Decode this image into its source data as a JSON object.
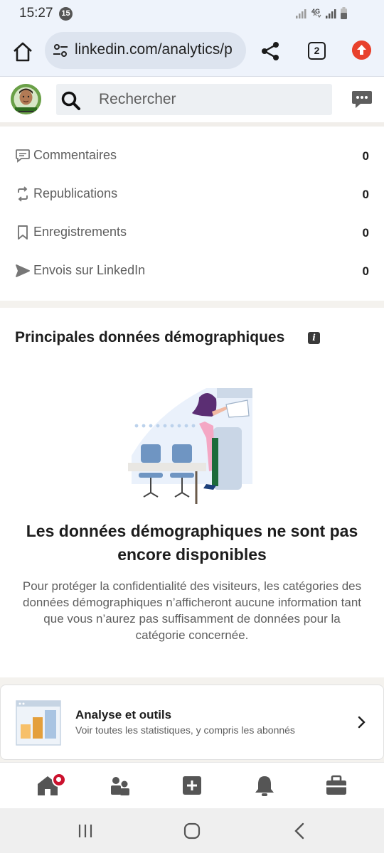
{
  "status_bar": {
    "time": "15:27",
    "notification_count": "15",
    "network": "4G"
  },
  "browser": {
    "url": "linkedin.com/analytics/p",
    "tab_count": "2"
  },
  "header": {
    "search_placeholder": "Rechercher"
  },
  "stats": [
    {
      "label": "Commentaires",
      "value": "0",
      "icon": "comment-icon"
    },
    {
      "label": "Republications",
      "value": "0",
      "icon": "repost-icon"
    },
    {
      "label": "Enregistrements",
      "value": "0",
      "icon": "bookmark-icon"
    },
    {
      "label": "Envois sur LinkedIn",
      "value": "0",
      "icon": "send-icon"
    }
  ],
  "demographics": {
    "title": "Principales données démographiques",
    "empty_heading": "Les données démographiques ne sont pas encore disponibles",
    "empty_body": "Pour protéger la confidentialité des visiteurs, les catégories des données démographiques n’afficheront aucune information tant que vous n’aurez pas suffisamment de données pour la catégorie concernée."
  },
  "tools": {
    "title": "Analyse et outils",
    "subtitle": "Voir toutes les statistiques, y compris les abonnés"
  },
  "bottom_nav": {
    "items": [
      "home-icon",
      "network-icon",
      "post-icon",
      "notifications-icon",
      "jobs-icon"
    ]
  },
  "colors": {
    "brand_red": "#cb112d",
    "text_primary": "#1d1d1d",
    "text_secondary": "#5e5e5e",
    "update_orange": "#e8412c"
  }
}
